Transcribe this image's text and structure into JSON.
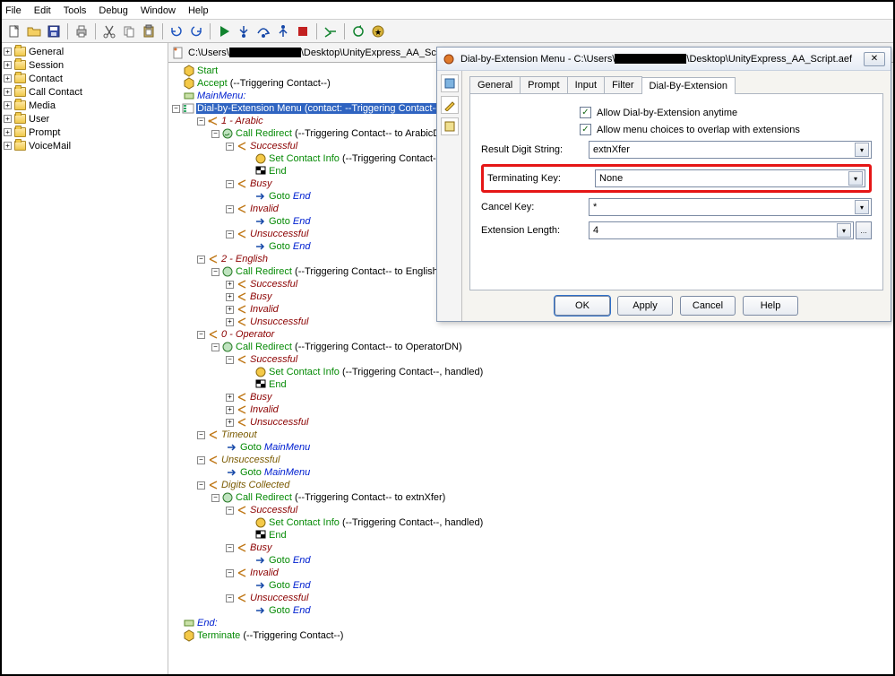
{
  "menu": {
    "file": "File",
    "edit": "Edit",
    "tools": "Tools",
    "debug": "Debug",
    "window": "Window",
    "help": "Help"
  },
  "toolbar_icons": {
    "new": "new-file-icon",
    "open": "open-folder-icon",
    "save": "save-icon",
    "print": "print-icon",
    "cut": "cut-icon",
    "copy": "copy-icon",
    "paste": "paste-icon",
    "undo": "undo-icon",
    "redo": "redo-icon",
    "run": "run-icon",
    "step_in": "step-into-icon",
    "step_over": "step-over-icon",
    "step_out": "step-out-icon",
    "stop": "stop-icon",
    "validate": "validate-icon",
    "refresh": "refresh-icon",
    "info": "info-icon"
  },
  "palette": [
    "General",
    "Session",
    "Contact",
    "Call Contact",
    "Media",
    "User",
    "Prompt",
    "VoiceMail"
  ],
  "script_tab": {
    "prefix": "C:\\Users\\",
    "suffix": "\\Desktop\\UnityExpress_AA_Script.aef"
  },
  "tree": {
    "start": "Start",
    "accept": "Accept",
    "accept_arg": " (--Triggering Contact--)",
    "mainmenu": "MainMenu:",
    "dial_menu": "Dial-by-Extension Menu (contact: --Triggering Contact--, p",
    "opt1": "1 - Arabic",
    "opt2": "2 - English",
    "opt0": "0 - Operator",
    "call_redirect": "Call Redirect",
    "cr_arabic_arg": " (--Triggering Contact-- to ArabicDN)",
    "cr_english_arg": " (--Triggering Contact-- to EnglishDN)",
    "cr_operator_arg": " (--Triggering Contact-- to OperatorDN)",
    "cr_extn_arg": " (--Triggering Contact-- to extnXfer)",
    "successful": "Successful",
    "busy": "Busy",
    "invalid": "Invalid",
    "unsuccessful": "Unsuccessful",
    "set_contact": "Set Contact Info",
    "set_contact_arg_h": " (--Triggering Contact--, handled)",
    "set_contact_arg_plain": " (--Triggering Contact--, ",
    "end_node": "End",
    "goto": "Goto",
    "goto_end": " End",
    "goto_mainmenu": " MainMenu",
    "timeout": "Timeout",
    "digits": "Digits Collected",
    "end_lbl": "End:",
    "terminate": "Terminate",
    "terminate_arg": " (--Triggering Contact--)"
  },
  "dialog": {
    "title_prefix": "Dial-by-Extension Menu - C:\\Users\\",
    "title_suffix": "\\Desktop\\UnityExpress_AA_Script.aef",
    "tabs": {
      "general": "General",
      "prompt": "Prompt",
      "input": "Input",
      "filter": "Filter",
      "dialby": "Dial-By-Extension"
    },
    "chk1": "Allow Dial-by-Extension anytime",
    "chk2": "Allow menu choices to overlap with extensions",
    "result_digit_label": "Result Digit String:",
    "result_digit_value": "extnXfer",
    "term_key_label": "Terminating Key:",
    "term_key_value": "None",
    "cancel_key_label": "Cancel Key:",
    "cancel_key_value": "*",
    "ext_len_label": "Extension Length:",
    "ext_len_value": "4",
    "buttons": {
      "ok": "OK",
      "apply": "Apply",
      "cancel": "Cancel",
      "help": "Help"
    }
  }
}
